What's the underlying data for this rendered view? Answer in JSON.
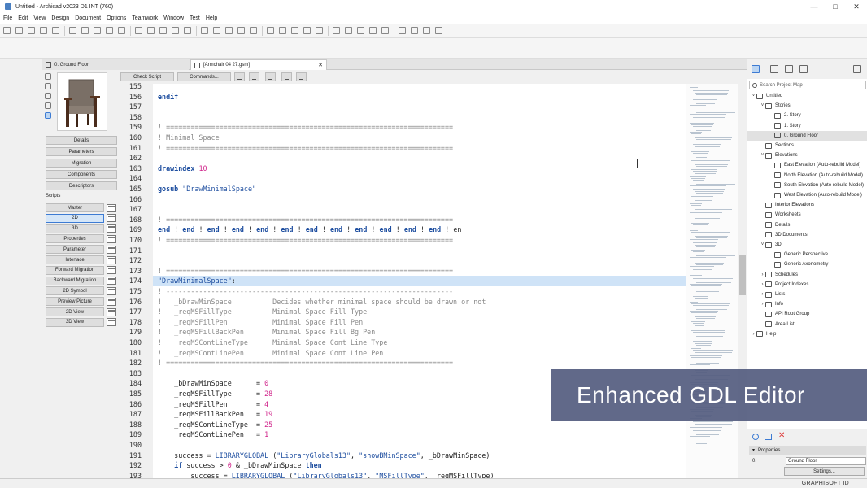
{
  "window": {
    "title": "Untitled - Archicad v2023 D1 INT (760)"
  },
  "menu": [
    "File",
    "Edit",
    "View",
    "Design",
    "Document",
    "Options",
    "Teamwork",
    "Window",
    "Test",
    "Help"
  ],
  "tabs": [
    {
      "label": "0. Ground Floor"
    },
    {
      "label": "[Armchair 04 27.gsm]"
    }
  ],
  "left_panel": {
    "buttons": [
      "Details",
      "Parameters",
      "Migration",
      "Components",
      "Descriptors"
    ],
    "scripts_label": "Scripts",
    "scripts": [
      "Master",
      "2D",
      "3D",
      "Properties",
      "Parameter",
      "Interface",
      "Forward Migration",
      "Backward Migration",
      "2D Symbol",
      "Preview Picture",
      "2D View",
      "3D View"
    ],
    "selected_script": "2D"
  },
  "editor_toolbar": {
    "check_script": "Check Script",
    "commands": "Commands..."
  },
  "code_lines": [
    {
      "n": "155",
      "t": ""
    },
    {
      "n": "156",
      "t": "endif"
    },
    {
      "n": "157",
      "t": ""
    },
    {
      "n": "158",
      "t": ""
    },
    {
      "n": "159",
      "t": "! ======================================================================"
    },
    {
      "n": "160",
      "t": "! Minimal Space"
    },
    {
      "n": "161",
      "t": "! ======================================================================"
    },
    {
      "n": "162",
      "t": ""
    },
    {
      "n": "163",
      "t": "drawindex 10"
    },
    {
      "n": "164",
      "t": ""
    },
    {
      "n": "165",
      "t": "gosub \"DrawMinimalSpace\""
    },
    {
      "n": "166",
      "t": ""
    },
    {
      "n": "167",
      "t": ""
    },
    {
      "n": "168",
      "t": "! ======================================================================"
    },
    {
      "n": "169",
      "t": "end ! end ! end ! end ! end ! end ! end ! end ! end ! end ! end ! end ! en"
    },
    {
      "n": "170",
      "t": "! ======================================================================"
    },
    {
      "n": "171",
      "t": ""
    },
    {
      "n": "172",
      "t": ""
    },
    {
      "n": "173",
      "t": "! ======================================================================"
    },
    {
      "n": "174",
      "t": "\"DrawMinimalSpace\":"
    },
    {
      "n": "175",
      "t": "! ----------------------------------------------------------------------"
    },
    {
      "n": "176",
      "t": "!   _bDrawMinSpace          Decides whether minimal space should be drawn or not"
    },
    {
      "n": "177",
      "t": "!   _reqMSFillType          Minimal Space Fill Type"
    },
    {
      "n": "178",
      "t": "!   _reqMSFillPen           Minimal Space Fill Pen"
    },
    {
      "n": "179",
      "t": "!   _reqMSFillBackPen       Minimal Space Fill Bg Pen"
    },
    {
      "n": "180",
      "t": "!   _reqMSContLineType      Minimal Space Cont Line Type"
    },
    {
      "n": "181",
      "t": "!   _reqMSContLinePen       Minimal Space Cont Line Pen"
    },
    {
      "n": "182",
      "t": "! ======================================================================"
    },
    {
      "n": "183",
      "t": ""
    },
    {
      "n": "184",
      "t": "    _bDrawMinSpace      = 0"
    },
    {
      "n": "185",
      "t": "    _reqMSFillType      = 28"
    },
    {
      "n": "186",
      "t": "    _reqMSFillPen       = 4"
    },
    {
      "n": "187",
      "t": "    _reqMSFillBackPen   = 19"
    },
    {
      "n": "188",
      "t": "    _reqMSContLineType  = 25"
    },
    {
      "n": "189",
      "t": "    _reqMSContLinePen   = 1"
    },
    {
      "n": "190",
      "t": ""
    },
    {
      "n": "191",
      "t": "    success = LIBRARYGLOBAL (\"LibraryGlobals13\", \"showBMinSpace\", _bDrawMinSpace)"
    },
    {
      "n": "192",
      "t": "    if success > 0 & _bDrawMinSpace then"
    },
    {
      "n": "193",
      "t": "        success = LIBRARYGLOBAL (\"LibraryGlobals13\", \"MSFillType\", _reqMSFillType)"
    }
  ],
  "highlight_line": "174",
  "project_map": {
    "search_placeholder": "Search Project Map",
    "items": [
      {
        "label": "Untitled",
        "depth": 0,
        "arrow": "v"
      },
      {
        "label": "Stories",
        "depth": 1,
        "arrow": "v"
      },
      {
        "label": "2. Story",
        "depth": 2,
        "arrow": ""
      },
      {
        "label": "1. Story",
        "depth": 2,
        "arrow": ""
      },
      {
        "label": "0. Ground Floor",
        "depth": 2,
        "arrow": "",
        "sel": true
      },
      {
        "label": "Sections",
        "depth": 1,
        "arrow": ""
      },
      {
        "label": "Elevations",
        "depth": 1,
        "arrow": "v"
      },
      {
        "label": "East Elevation (Auto-rebuild Model)",
        "depth": 2,
        "arrow": ""
      },
      {
        "label": "North Elevation (Auto-rebuild Model)",
        "depth": 2,
        "arrow": ""
      },
      {
        "label": "South Elevation (Auto-rebuild Model)",
        "depth": 2,
        "arrow": ""
      },
      {
        "label": "West Elevation (Auto-rebuild Model)",
        "depth": 2,
        "arrow": ""
      },
      {
        "label": "Interior Elevations",
        "depth": 1,
        "arrow": ""
      },
      {
        "label": "Worksheets",
        "depth": 1,
        "arrow": ""
      },
      {
        "label": "Details",
        "depth": 1,
        "arrow": ""
      },
      {
        "label": "3D Documents",
        "depth": 1,
        "arrow": ""
      },
      {
        "label": "3D",
        "depth": 1,
        "arrow": "v"
      },
      {
        "label": "Generic Perspective",
        "depth": 2,
        "arrow": ""
      },
      {
        "label": "Generic Axonometry",
        "depth": 2,
        "arrow": ""
      },
      {
        "label": "Schedules",
        "depth": 1,
        "arrow": ">"
      },
      {
        "label": "Project Indexes",
        "depth": 1,
        "arrow": ">"
      },
      {
        "label": "Lists",
        "depth": 1,
        "arrow": ">"
      },
      {
        "label": "Info",
        "depth": 1,
        "arrow": ">"
      },
      {
        "label": "API Root Group",
        "depth": 1,
        "arrow": ""
      },
      {
        "label": "Area List",
        "depth": 1,
        "arrow": ""
      },
      {
        "label": "Help",
        "depth": 0,
        "arrow": ">"
      }
    ]
  },
  "properties": {
    "header": "Properties",
    "field_label": "0.",
    "field_value": "Ground Floor",
    "settings": "Settings..."
  },
  "status": {
    "brand": "GRAPHISOFT ID"
  },
  "overlay": {
    "text": "Enhanced GDL Editor"
  }
}
